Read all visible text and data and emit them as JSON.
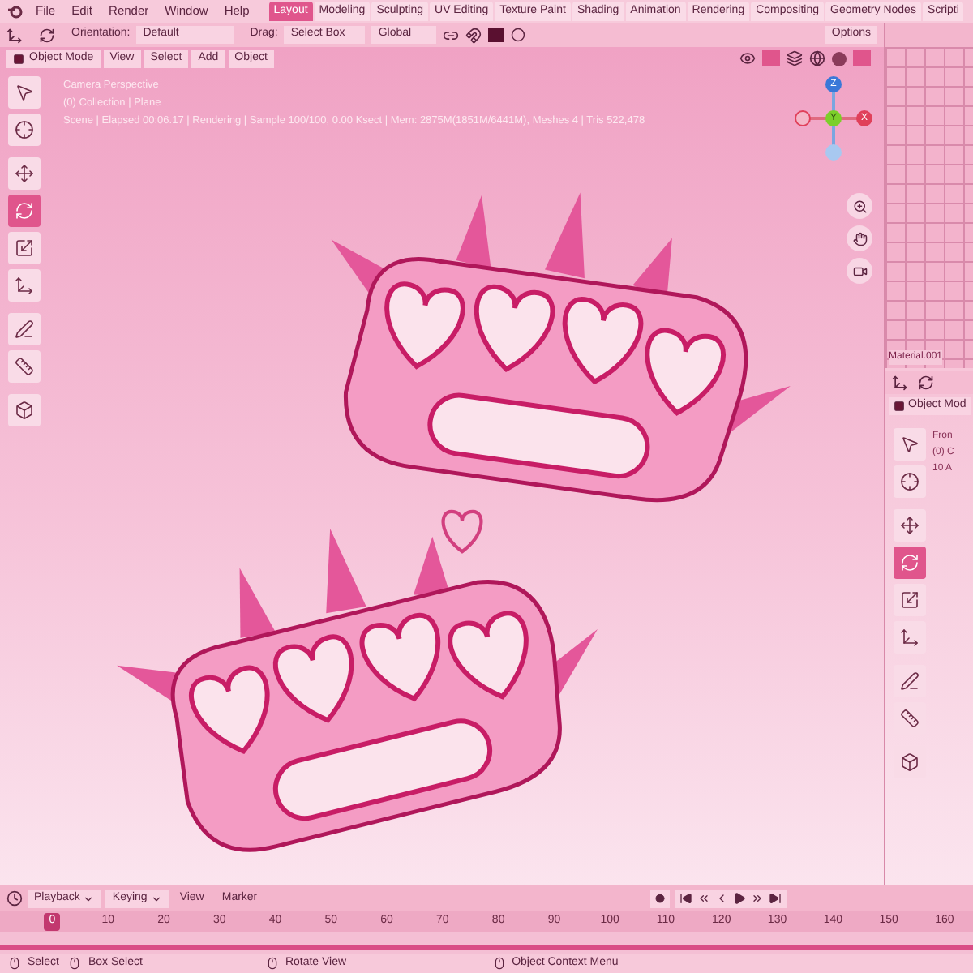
{
  "menu": [
    "File",
    "Edit",
    "Render",
    "Window",
    "Help"
  ],
  "workspace_tabs": [
    {
      "label": "Layout",
      "selected": true
    },
    {
      "label": "Modeling",
      "selected": false
    },
    {
      "label": "Sculpting",
      "selected": false
    },
    {
      "label": "UV Editing",
      "selected": false
    },
    {
      "label": "Texture Paint",
      "selected": false
    },
    {
      "label": "Shading",
      "selected": false
    },
    {
      "label": "Animation",
      "selected": false
    },
    {
      "label": "Rendering",
      "selected": false
    },
    {
      "label": "Compositing",
      "selected": false
    },
    {
      "label": "Geometry Nodes",
      "selected": false
    },
    {
      "label": "Scripti",
      "selected": false
    }
  ],
  "tool_header": {
    "orientation_label": "Orientation:",
    "orientation_value": "Default",
    "drag_label": "Drag:",
    "drag_value": "Select Box",
    "pivot": "Global",
    "options": "Options"
  },
  "viewport": {
    "mode": "Object Mode",
    "menus": [
      "View",
      "Select",
      "Add",
      "Object"
    ],
    "overlay_lines": [
      "Camera Perspective",
      "(0) Collection | Plane",
      "Scene | Elapsed 00:06.17 | Rendering | Sample 100/100, 0.00 Ksect | Mem: 2875M(1851M/6441M), Meshes 4 | Tris 522,478"
    ],
    "tools": [
      {
        "kind": "select",
        "selected": false
      },
      {
        "kind": "cursor",
        "selected": false
      },
      {
        "kind": "move",
        "selected": false
      },
      {
        "kind": "rotate",
        "selected": true
      },
      {
        "kind": "scale",
        "selected": false
      },
      {
        "kind": "transform",
        "selected": false
      },
      {
        "kind": "annotate",
        "selected": false
      },
      {
        "kind": "measure",
        "selected": false
      },
      {
        "kind": "add-cube",
        "selected": false
      }
    ],
    "gizmo": {
      "z": "Z",
      "y": "Y",
      "x": "X"
    }
  },
  "right_area": {
    "grid_label": "Material.001",
    "mode": "Object Mod",
    "overlay_lines": [
      "Fron",
      "(0) C",
      "10 A"
    ],
    "tools": [
      {
        "kind": "select",
        "selected": false
      },
      {
        "kind": "cursor",
        "selected": false
      },
      {
        "kind": "move",
        "selected": false
      },
      {
        "kind": "rotate",
        "selected": true
      },
      {
        "kind": "scale",
        "selected": false
      },
      {
        "kind": "transform",
        "selected": false
      },
      {
        "kind": "annotate",
        "selected": false
      },
      {
        "kind": "measure",
        "selected": false
      },
      {
        "kind": "add-cube",
        "selected": false
      }
    ]
  },
  "timeline": {
    "menus": [
      {
        "label": "Playback",
        "dropdown": true
      },
      {
        "label": "Keying",
        "dropdown": true
      },
      {
        "label": "View",
        "dropdown": false
      },
      {
        "label": "Marker",
        "dropdown": false
      }
    ],
    "ticks": [
      {
        "label": "0",
        "selected": true
      },
      {
        "label": "10",
        "selected": false
      },
      {
        "label": "20",
        "selected": false
      },
      {
        "label": "30",
        "selected": false
      },
      {
        "label": "40",
        "selected": false
      },
      {
        "label": "50",
        "selected": false
      },
      {
        "label": "60",
        "selected": false
      },
      {
        "label": "70",
        "selected": false
      },
      {
        "label": "80",
        "selected": false
      },
      {
        "label": "90",
        "selected": false
      },
      {
        "label": "100",
        "selected": false
      },
      {
        "label": "110",
        "selected": false
      },
      {
        "label": "120",
        "selected": false
      },
      {
        "label": "130",
        "selected": false
      },
      {
        "label": "140",
        "selected": false
      },
      {
        "label": "150",
        "selected": false
      },
      {
        "label": "160",
        "selected": false
      }
    ]
  },
  "status_bar": [
    {
      "kind": "left",
      "label": "Select"
    },
    {
      "kind": "left-drag",
      "label": "Box Select"
    },
    {
      "kind": "middle",
      "label": "Rotate View"
    },
    {
      "kind": "right",
      "label": "Object Context Menu"
    }
  ]
}
